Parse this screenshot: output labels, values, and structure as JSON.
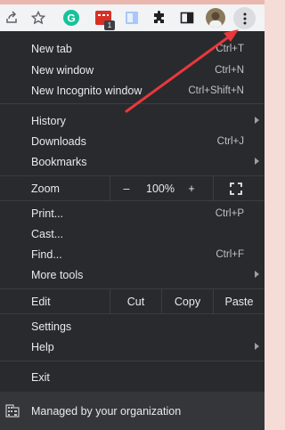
{
  "toolbar": {
    "icons": [
      "share-icon",
      "star-icon",
      "grammarly-icon",
      "extension-red-icon",
      "reading-list-icon",
      "puzzle-icon",
      "sidebar-icon",
      "avatar",
      "kebab-menu-icon"
    ],
    "extension_badge": "1"
  },
  "menu": {
    "new_tab": {
      "label": "New tab",
      "shortcut": "Ctrl+T"
    },
    "new_window": {
      "label": "New window",
      "shortcut": "Ctrl+N"
    },
    "new_incognito": {
      "label": "New Incognito window",
      "shortcut": "Ctrl+Shift+N"
    },
    "history": {
      "label": "History"
    },
    "downloads": {
      "label": "Downloads",
      "shortcut": "Ctrl+J"
    },
    "bookmarks": {
      "label": "Bookmarks"
    },
    "zoom": {
      "label": "Zoom",
      "minus": "–",
      "value": "100%",
      "plus": "+"
    },
    "print": {
      "label": "Print...",
      "shortcut": "Ctrl+P"
    },
    "cast": {
      "label": "Cast..."
    },
    "find": {
      "label": "Find...",
      "shortcut": "Ctrl+F"
    },
    "more_tools": {
      "label": "More tools"
    },
    "edit": {
      "label": "Edit",
      "cut": "Cut",
      "copy": "Copy",
      "paste": "Paste"
    },
    "settings": {
      "label": "Settings"
    },
    "help": {
      "label": "Help"
    },
    "exit": {
      "label": "Exit"
    },
    "managed": {
      "label": "Managed by your organization"
    }
  },
  "colors": {
    "menu_bg": "#292a2d",
    "footer_bg": "#35363a",
    "annotation_arrow": "#e8383d",
    "grammarly": "#15c39a"
  }
}
